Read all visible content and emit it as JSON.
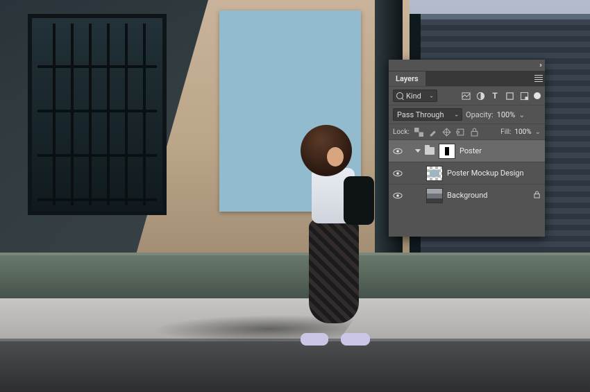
{
  "panel": {
    "title": "Layers",
    "filter": {
      "kind_label": "Kind"
    },
    "blend": {
      "mode": "Pass Through",
      "opacity_label": "Opacity:",
      "opacity_value": "100%"
    },
    "lock": {
      "label": "Lock:",
      "fill_label": "Fill:",
      "fill_value": "100%"
    },
    "layers": [
      {
        "name": "Poster"
      },
      {
        "name": "Poster Mockup Design"
      },
      {
        "name": "Background"
      }
    ]
  }
}
